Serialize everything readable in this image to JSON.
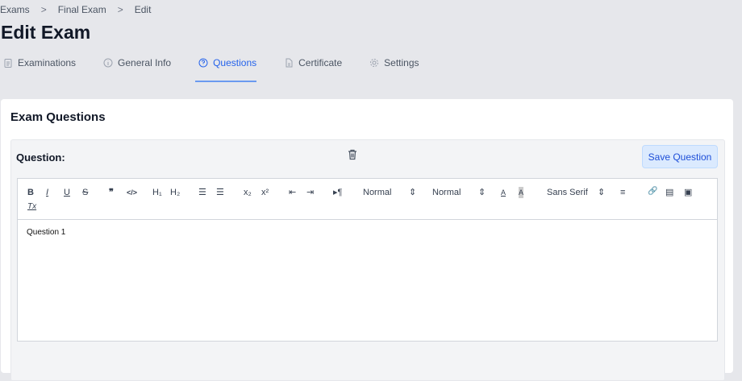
{
  "breadcrumb": [
    "Exams",
    "Final Exam",
    "Edit"
  ],
  "breadcrumb_sep": ">",
  "title": "Edit Exam",
  "tabs": [
    {
      "label": "Examinations"
    },
    {
      "label": "General Info"
    },
    {
      "label": "Questions"
    },
    {
      "label": "Certificate"
    },
    {
      "label": "Settings"
    }
  ],
  "card_title": "Exam Questions",
  "question_label": "Question:",
  "save_label": "Save Question",
  "toolbar": {
    "bold": "B",
    "italic": "I",
    "underline": "U",
    "strike": "S",
    "quote": "❞",
    "code": "</>",
    "h1": "H₁",
    "h2": "H₂",
    "ol": "☰",
    "ul": "☰",
    "sub": "x₂",
    "sup": "x²",
    "outdent": "⇤",
    "indent": "⇥",
    "direction": "▸¶",
    "size1": "Normal",
    "size2": "Normal",
    "color": "A",
    "bg": "A",
    "font": "Sans Serif",
    "align": "≡",
    "link": "🔗",
    "video": "▤",
    "image": "▣",
    "clean": "Tx",
    "caret": "⇕"
  },
  "content": "Question 1",
  "colors": {
    "accent": "#2563eb",
    "bg": "#e6e7eb"
  }
}
